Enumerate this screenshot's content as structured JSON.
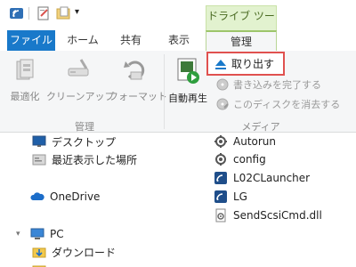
{
  "context_tab": {
    "label": "ドライブ ツール"
  },
  "tabs": [
    {
      "label": "ファイル"
    },
    {
      "label": "ホーム"
    },
    {
      "label": "共有"
    },
    {
      "label": "表示"
    },
    {
      "label": "管理"
    }
  ],
  "ribbon": {
    "manage_group": {
      "label": "管理",
      "buttons": [
        {
          "label": "最適化",
          "icon": "optimize-icon"
        },
        {
          "label": "クリーンアップ",
          "icon": "cleanup-icon"
        },
        {
          "label": "フォーマット",
          "icon": "format-icon"
        }
      ]
    },
    "media_group": {
      "label": "メディア",
      "autoplay": {
        "label": "自動再生",
        "icon": "autoplay-icon"
      },
      "eject": {
        "label": "取り出す",
        "icon": "eject-icon"
      },
      "finish_burn": {
        "label": "書き込みを完了する",
        "icon": "finish-burn-icon"
      },
      "erase_disc": {
        "label": "このディスクを消去する",
        "icon": "erase-disc-icon"
      }
    }
  },
  "nav_pane": {
    "items": [
      {
        "label": "デスクトップ",
        "icon": "desktop-icon"
      },
      {
        "label": "最近表示した場所",
        "icon": "recent-places-icon"
      },
      {
        "label": "OneDrive",
        "icon": "onedrive-icon"
      },
      {
        "label": "PC",
        "icon": "pc-icon"
      },
      {
        "label": "ダウンロード",
        "icon": "downloads-folder-icon"
      }
    ]
  },
  "files": [
    {
      "name": "Autorun",
      "icon": "autorun-file-icon"
    },
    {
      "name": "config",
      "icon": "config-file-icon"
    },
    {
      "name": "L02CLauncher",
      "icon": "app-icon"
    },
    {
      "name": "LG",
      "icon": "app-icon"
    },
    {
      "name": "SendScsiCmd.dll",
      "icon": "dll-file-icon"
    }
  ],
  "colors": {
    "file_tab": "#1979ca",
    "context_green": "#9dc56b",
    "highlight_red": "#e0514f"
  }
}
